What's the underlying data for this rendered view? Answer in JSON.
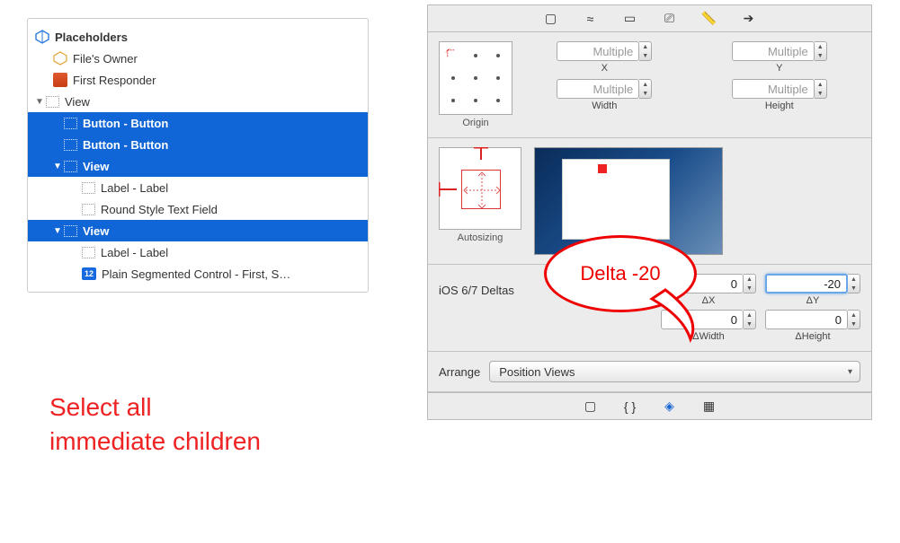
{
  "outline": {
    "placeholders": "Placeholders",
    "filesOwner": "File's Owner",
    "firstResponder": "First Responder",
    "view": "View",
    "buttonButton": "Button - Button",
    "labelLabel": "Label - Label",
    "roundTextField": "Round Style Text Field",
    "plainSeg": "Plain Segmented Control - First, S…",
    "segBadge": "12"
  },
  "annotation": {
    "leftLine1": "Select all",
    "leftLine2": "immediate children",
    "bubble": "Delta -20"
  },
  "inspector": {
    "originLabel": "Origin",
    "xLabel": "X",
    "yLabel": "Y",
    "widthLabel": "Width",
    "heightLabel": "Height",
    "multiple": "Multiple",
    "autosizing": "Autosizing",
    "deltasLabel": "iOS 6/7 Deltas",
    "dx": "0",
    "dy": "-20",
    "dxLabel": "ΔX",
    "dyLabel": "ΔY",
    "dw": "0",
    "dh": "0",
    "dwLabel": "ΔWidth",
    "dhLabel": "ΔHeight",
    "arrangeLabel": "Arrange",
    "arrangeValue": "Position Views"
  }
}
